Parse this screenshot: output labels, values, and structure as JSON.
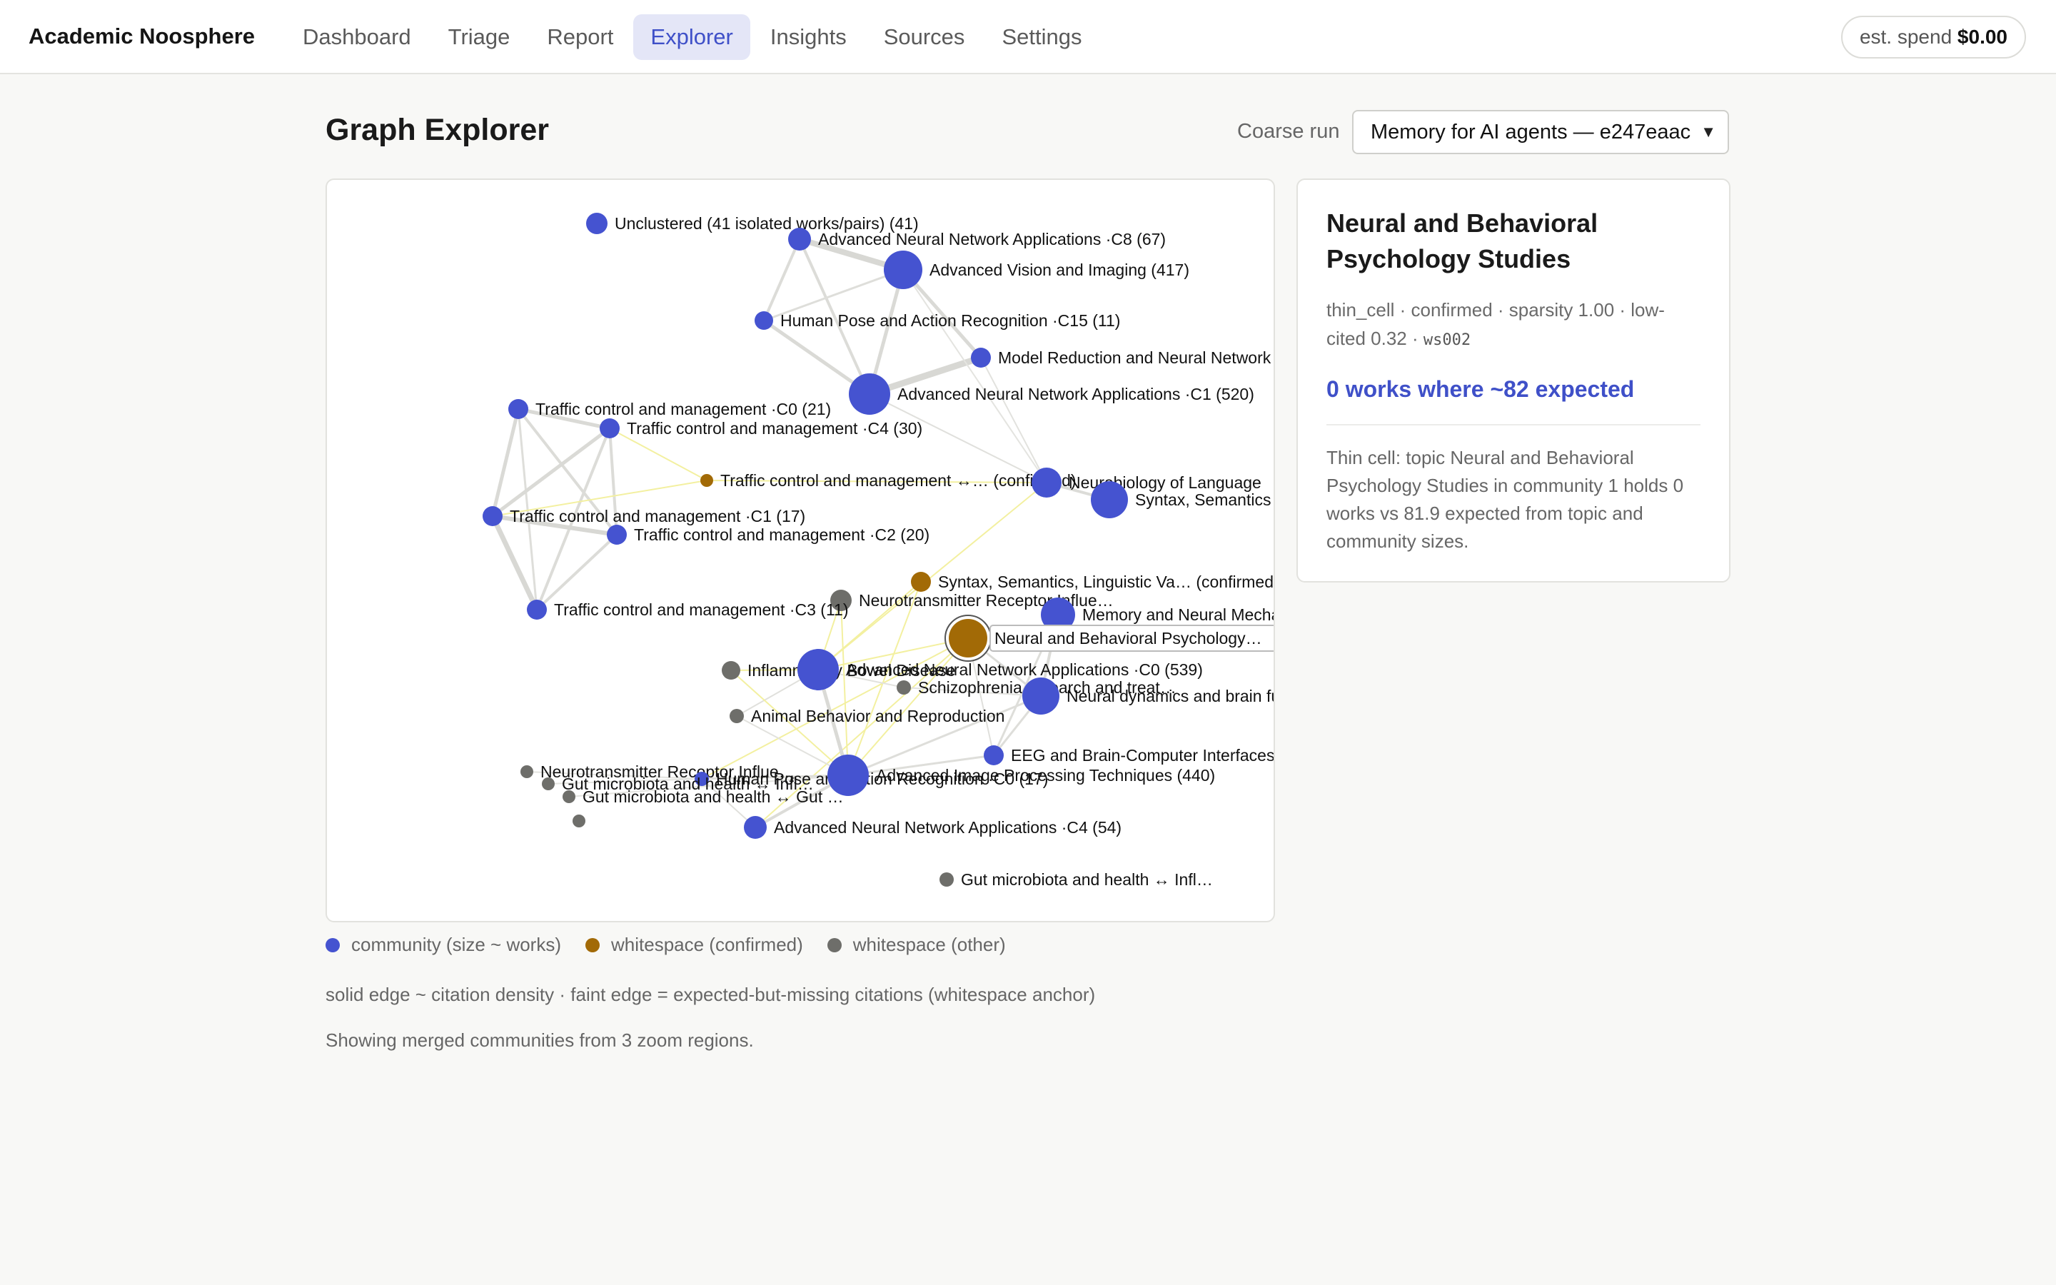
{
  "app": {
    "brand": "Academic Noosphere"
  },
  "nav": {
    "items": [
      {
        "label": "Dashboard"
      },
      {
        "label": "Triage"
      },
      {
        "label": "Report"
      },
      {
        "label": "Explorer",
        "active": true
      },
      {
        "label": "Insights"
      },
      {
        "label": "Sources"
      },
      {
        "label": "Settings"
      }
    ]
  },
  "spend": {
    "label": "est. spend",
    "value": "$0.00"
  },
  "page": {
    "title": "Graph Explorer"
  },
  "run": {
    "label": "Coarse run",
    "selected": "Memory for AI agents — e247eaac"
  },
  "graph": {
    "colors": {
      "community": "#4553d0",
      "confirmed": "#a26a06",
      "other": "#6e6e6a"
    },
    "nodes": [
      {
        "id": "n1",
        "type": "community",
        "label": "Unclustered (41 isolated works/pairs) (41)"
      },
      {
        "id": "n2",
        "type": "community",
        "label": "Advanced Neural Network Applications ·C8 (67)"
      },
      {
        "id": "n3",
        "type": "community",
        "label": "Advanced Vision and Imaging (417)"
      },
      {
        "id": "n4",
        "type": "community",
        "label": "Human Pose and Action Recognition ·C15 (11)"
      },
      {
        "id": "n5",
        "type": "community",
        "label": "Model Reduction and Neural Network"
      },
      {
        "id": "n6",
        "type": "community",
        "label": "Advanced Neural Network Applications ·C1 (520)"
      },
      {
        "id": "n7",
        "type": "community",
        "label": "Traffic control and management ·C0 (21)"
      },
      {
        "id": "n8",
        "type": "community",
        "label": "Traffic control and management ·C4 (30)"
      },
      {
        "id": "n9",
        "type": "confirmed",
        "label": "Traffic control and management ↔… (confirmed)"
      },
      {
        "id": "n10",
        "type": "community",
        "label": "Neurobiology of Language"
      },
      {
        "id": "n11",
        "type": "community",
        "label": "Syntax, Semantics"
      },
      {
        "id": "n12",
        "type": "community",
        "label": "Traffic control and management ·C1 (17)"
      },
      {
        "id": "n13",
        "type": "community",
        "label": "Traffic control and management ·C2 (20)"
      },
      {
        "id": "n14",
        "type": "confirmed",
        "label": "Syntax, Semantics, Linguistic Va… (confirmed)"
      },
      {
        "id": "n15",
        "type": "other",
        "label": "Neurotransmitter Receptor Influe…"
      },
      {
        "id": "n16",
        "type": "community",
        "label": "Traffic control and management ·C3 (11)"
      },
      {
        "id": "n17",
        "type": "community",
        "label": "Memory and Neural Mechanisms"
      },
      {
        "id": "n18",
        "type": "confirmed",
        "label": "Neural and Behavioral Psychology…",
        "selected": true
      },
      {
        "id": "n19",
        "type": "other",
        "label": "Inflammatory Bowel Disease"
      },
      {
        "id": "n20",
        "type": "community",
        "label": "Advanced Neural Network Applications ·C0 (539)"
      },
      {
        "id": "n21",
        "type": "other",
        "label": "Schizophrenia research and treat…"
      },
      {
        "id": "n22",
        "type": "community",
        "label": "Neural dynamics and brain function"
      },
      {
        "id": "n23",
        "type": "other",
        "label": "Animal Behavior and Reproduction"
      },
      {
        "id": "n24",
        "type": "community",
        "label": "EEG and Brain-Computer Interfaces"
      },
      {
        "id": "n25",
        "type": "other",
        "label": "Neurotransmitter Receptor Influe…"
      },
      {
        "id": "n26",
        "type": "community",
        "label": "Human Pose and Action Recognition ·C0 (17)"
      },
      {
        "id": "n27",
        "type": "community",
        "label": "Advanced Image Processing Techniques (440)"
      },
      {
        "id": "n28",
        "type": "other",
        "label": "Gut microbiota and health ↔ Infl…"
      },
      {
        "id": "n29",
        "type": "other",
        "label": "Gut microbiota and health ↔ Gut …"
      },
      {
        "id": "n30",
        "type": "other",
        "label": ""
      },
      {
        "id": "n31",
        "type": "community",
        "label": "Advanced Neural Network Applications ·C4 (54)"
      },
      {
        "id": "n32",
        "type": "other",
        "label": "Gut microbiota and health ↔ Infl…"
      }
    ]
  },
  "detail": {
    "title": "Neural and Behavioral Psychology Studies",
    "meta_text": "thin_cell · confirmed · sparsity 1.00 · low-cited 0.32 ·",
    "meta_code": "ws002",
    "headline": "0 works where ~82 expected",
    "description": "Thin cell: topic Neural and Behavioral Psychology Studies in community 1 holds 0 works vs 81.9 expected from topic and community sizes."
  },
  "legend": [
    {
      "type": "community",
      "label": "community (size ~ works)"
    },
    {
      "type": "confirmed",
      "label": "whitespace (confirmed)"
    },
    {
      "type": "other",
      "label": "whitespace (other)"
    }
  ],
  "notes": {
    "edges": "solid edge ~ citation density · faint edge = expected-but-missing citations (whitespace anchor)",
    "regions": "Showing merged communities from 3 zoom regions."
  }
}
